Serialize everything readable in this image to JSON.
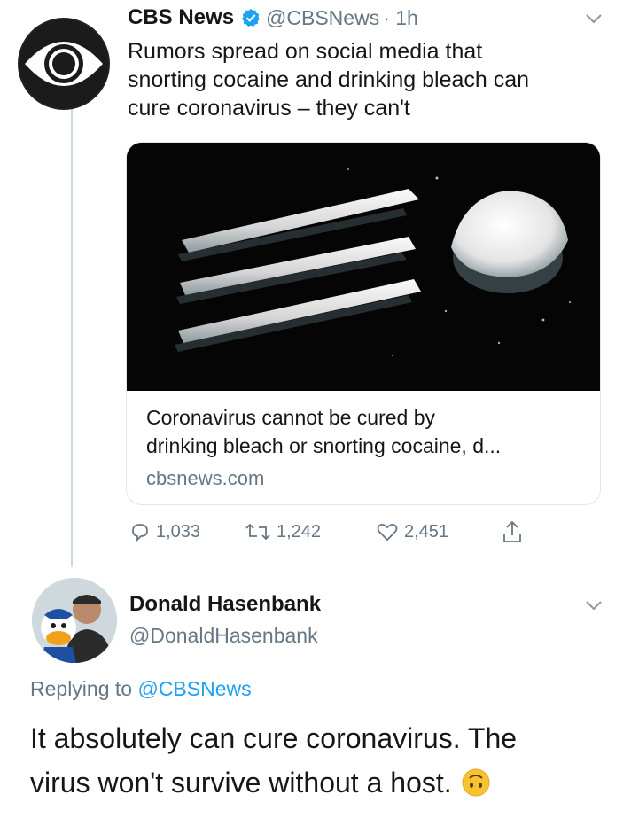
{
  "tweet": {
    "author_name": "CBS News",
    "handle": "@CBSNews",
    "time": "· 1h",
    "text_lines": [
      "Rumors spread on social media that",
      "snorting cocaine and drinking bleach can",
      "cure coronavirus – they can't"
    ],
    "card": {
      "title_lines": [
        "Coronavirus cannot be cured by",
        "drinking bleach or snorting cocaine, d..."
      ],
      "domain": "cbsnews.com"
    },
    "actions": {
      "replies": "1,033",
      "retweets": "1,242",
      "likes": "2,451"
    }
  },
  "reply": {
    "author_name": "Donald Hasenbank",
    "handle": "@DonaldHasenbank",
    "replying_prefix": "Replying to",
    "replying_to": "@CBSNews",
    "text_lines": [
      "It absolutely can cure coronavirus. The",
      "virus won't survive without a host."
    ],
    "emoji": "upside-down-face-icon"
  },
  "colors": {
    "link": "#1da1f2",
    "secondary": "#657786",
    "verified": "#1da1f2"
  }
}
